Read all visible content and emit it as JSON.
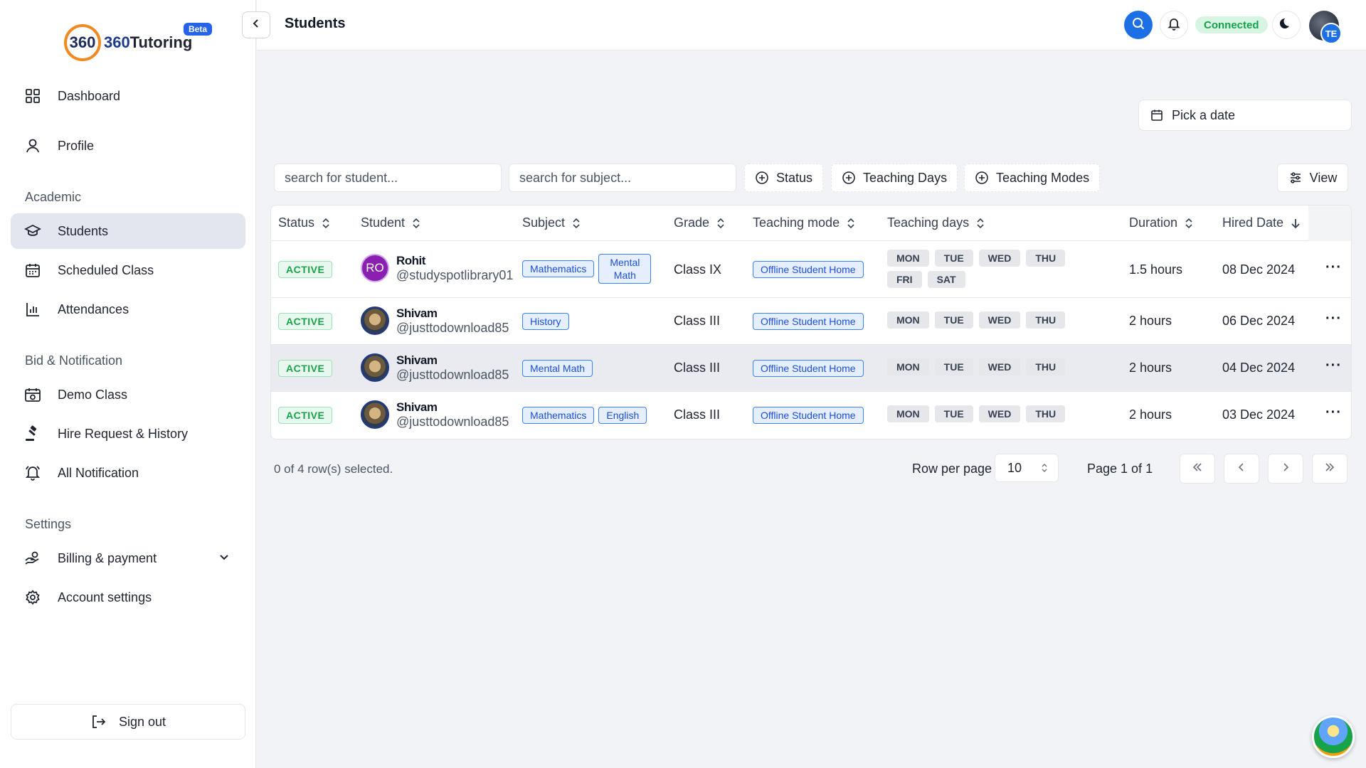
{
  "app": {
    "logo_mark": "360",
    "logo_brand": "360",
    "logo_name": "Tutoring",
    "beta": "Beta"
  },
  "header": {
    "title": "Students",
    "status": "Connected",
    "avatar_initials": "TE"
  },
  "sidebar": {
    "top_items": [
      {
        "label": "Dashboard",
        "icon": "grid-icon"
      },
      {
        "label": "Profile",
        "icon": "user-icon"
      }
    ],
    "sections": [
      {
        "label": "Academic"
      },
      {
        "label": "Bid & Notification"
      },
      {
        "label": "Settings"
      }
    ],
    "academic_items": [
      {
        "label": "Students",
        "icon": "graduation-cap-icon",
        "active": true
      },
      {
        "label": "Scheduled Class",
        "icon": "calendar-icon"
      },
      {
        "label": "Attendances",
        "icon": "bar-chart-icon"
      }
    ],
    "bid_items": [
      {
        "label": "Demo Class",
        "icon": "calendar-check-icon"
      },
      {
        "label": "Hire Request & History",
        "icon": "gavel-icon"
      },
      {
        "label": "All Notification",
        "icon": "bell-ring-icon"
      }
    ],
    "settings_items": [
      {
        "label": "Billing & payment",
        "icon": "hand-coins-icon"
      },
      {
        "label": "Account settings",
        "icon": "gear-icon"
      }
    ],
    "sign_out": "Sign out"
  },
  "toolbar": {
    "date_placeholder": "Pick a date",
    "student_search_placeholder": "search for student...",
    "subject_search_placeholder": "search for subject...",
    "filters": [
      "Status",
      "Teaching Days",
      "Teaching Modes"
    ],
    "view": "View"
  },
  "table": {
    "columns": [
      "Status",
      "Student",
      "Subject",
      "Grade",
      "Teaching mode",
      "Teaching days",
      "Duration",
      "Hired Date"
    ],
    "rows": [
      {
        "status": "ACTIVE",
        "avatar": "RO",
        "name": "Rohit",
        "handle": "@studyspotlibrary01",
        "subjects": [
          "Mathematics",
          "Mental Math"
        ],
        "grade": "Class IX",
        "mode": "Offline Student Home",
        "days": [
          "MON",
          "TUE",
          "WED",
          "THU",
          "FRI",
          "SAT"
        ],
        "duration": "1.5 hours",
        "hired": "08 Dec 2024"
      },
      {
        "status": "ACTIVE",
        "avatar": "",
        "name": "Shivam",
        "handle": "@justtodownload85",
        "subjects": [
          "History"
        ],
        "grade": "Class III",
        "mode": "Offline Student Home",
        "days": [
          "MON",
          "TUE",
          "WED",
          "THU"
        ],
        "duration": "2 hours",
        "hired": "06 Dec 2024"
      },
      {
        "status": "ACTIVE",
        "avatar": "",
        "name": "Shivam",
        "handle": "@justtodownload85",
        "subjects": [
          "Mental Math"
        ],
        "grade": "Class III",
        "mode": "Offline Student Home",
        "days": [
          "MON",
          "TUE",
          "WED",
          "THU"
        ],
        "duration": "2 hours",
        "hired": "04 Dec 2024"
      },
      {
        "status": "ACTIVE",
        "avatar": "",
        "name": "Shivam",
        "handle": "@justtodownload85",
        "subjects": [
          "Mathematics",
          "English"
        ],
        "grade": "Class III",
        "mode": "Offline Student Home",
        "days": [
          "MON",
          "TUE",
          "WED",
          "THU"
        ],
        "duration": "2 hours",
        "hired": "03 Dec 2024"
      }
    ]
  },
  "pagination": {
    "selected": "0 of 4 row(s) selected.",
    "rows_per_page_label": "Row per page",
    "rows_per_page": "10",
    "page_info": "Page 1 of 1"
  },
  "colors": {
    "accent": "#1d6fe6",
    "active_green": "#16a34a",
    "tag_blue": "#1d4ed8"
  }
}
